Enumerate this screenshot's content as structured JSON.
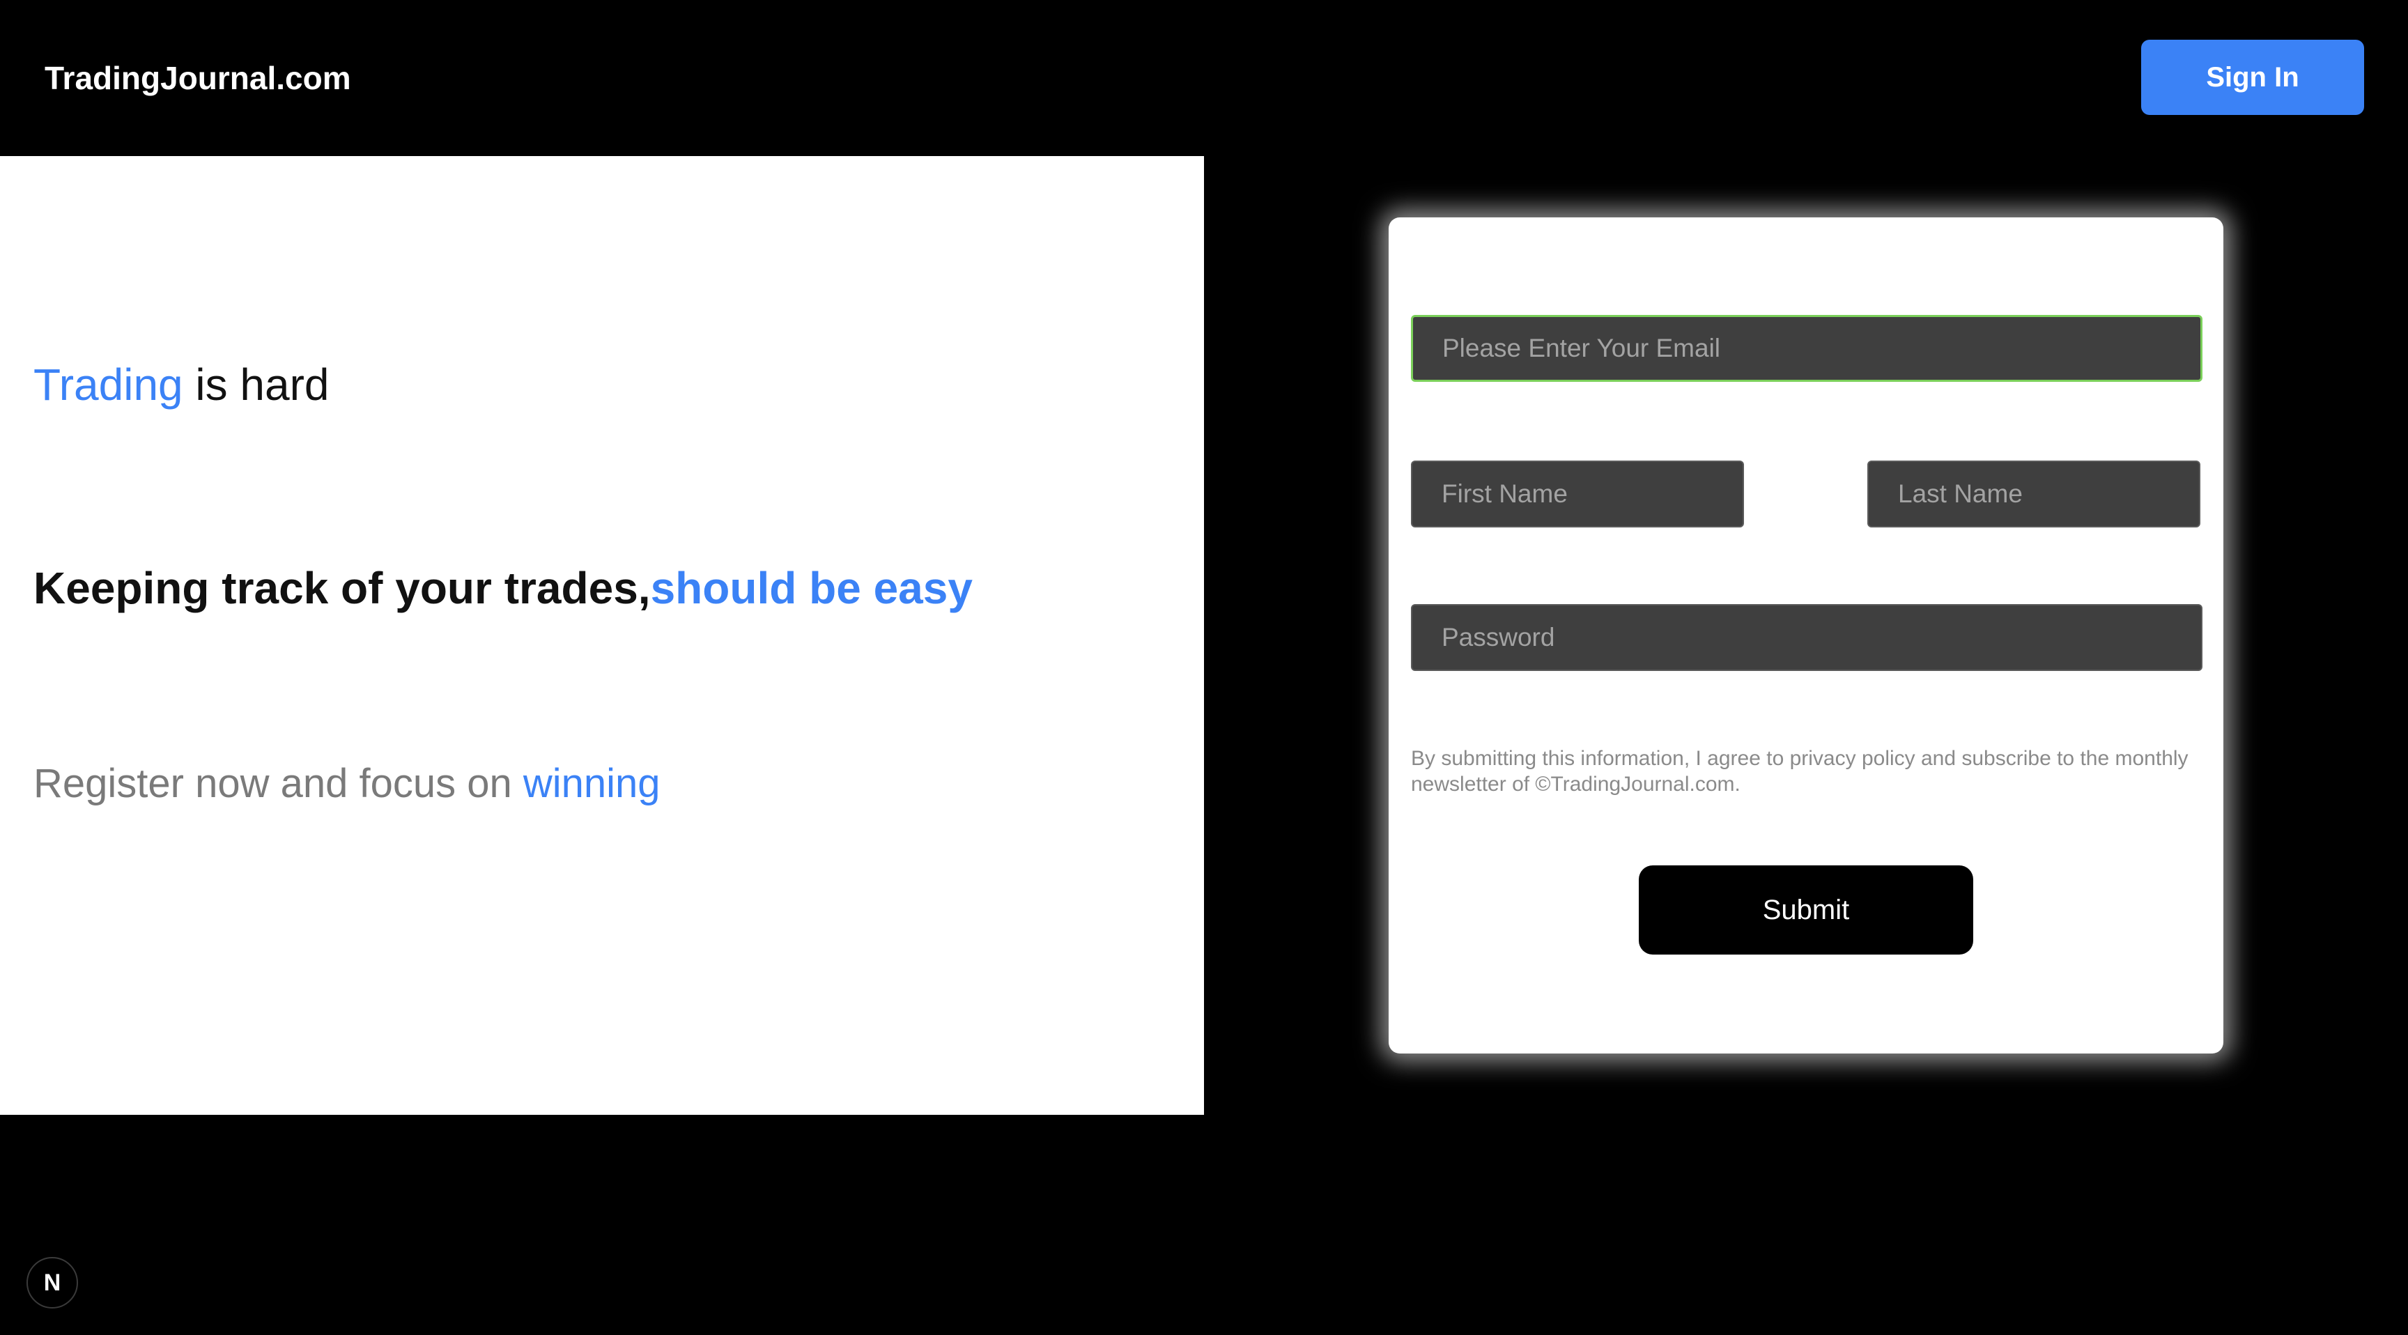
{
  "header": {
    "logo_text": "TradingJournal.com",
    "signin_label": "Sign In"
  },
  "hero": {
    "line1_highlight": "Trading",
    "line1_rest": " is hard",
    "line2_main": "Keeping track of your trades,",
    "line2_highlight": "should be easy",
    "line3_main": "Register now and focus on ",
    "line3_highlight": "winning"
  },
  "form": {
    "email_placeholder": "Please Enter Your Email",
    "first_name_placeholder": "First Name",
    "last_name_placeholder": "Last Name",
    "password_placeholder": "Password",
    "disclaimer": "By submitting this information, I agree to privacy policy and subscribe to the monthly newsletter of ©TradingJournal.com.",
    "submit_label": "Submit"
  },
  "badge": {
    "label": "N",
    "icon": "nextjs-icon"
  },
  "colors": {
    "accent": "#3b82f6",
    "email_focus_border": "#7bd05a",
    "input_bg": "#3f3f3f",
    "page_bg": "#000000"
  }
}
